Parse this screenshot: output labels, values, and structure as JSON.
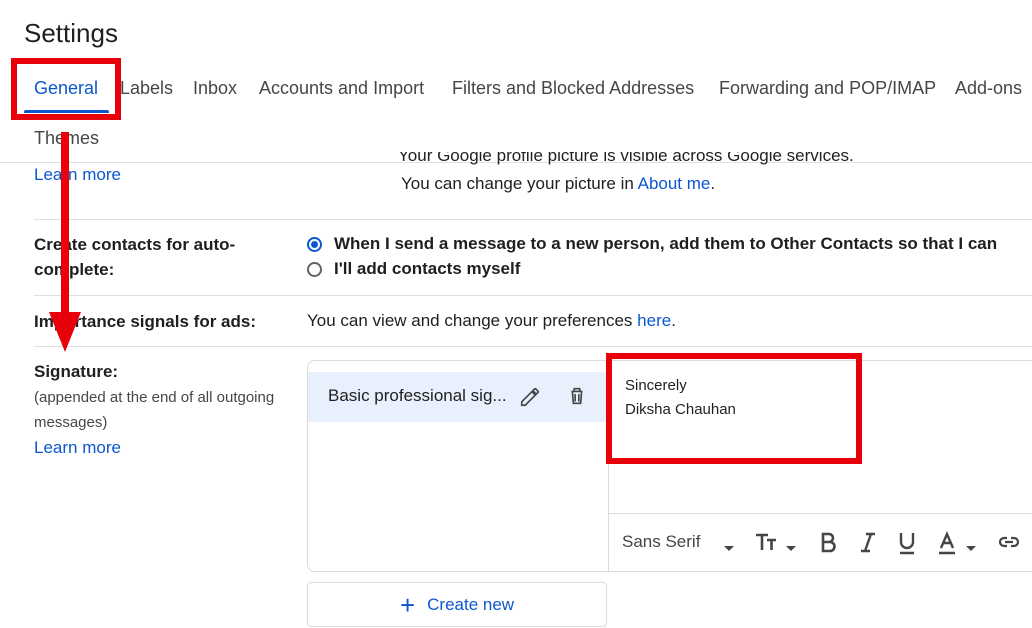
{
  "page_title": "Settings",
  "tabs": [
    "General",
    "Labels",
    "Inbox",
    "Accounts and Import",
    "Filters and Blocked Addresses",
    "Forwarding and POP/IMAP",
    "Add-ons",
    "Themes"
  ],
  "picture": {
    "clipped_line": "Your Google profile picture is visible across Google services.",
    "change_prefix": "You can change your picture in ",
    "about_me_link": "About me",
    "change_suffix": ".",
    "learn_more": "Learn more"
  },
  "auto_complete": {
    "label_line1": "Create contacts for auto-",
    "label_line2": "complete:",
    "option1": "When I send a message to a new person, add them to Other Contacts so that I can",
    "option2": "I'll add contacts myself"
  },
  "importance": {
    "label": "Importance signals for ads:",
    "text_prefix": "You can view and change your preferences ",
    "here_link": "here",
    "text_suffix": "."
  },
  "signature": {
    "label": "Signature:",
    "sub_line1": "(appended at the end of all outgoing",
    "sub_line2": "messages)",
    "learn_more": "Learn more",
    "item_name": "Basic professional sig...",
    "body_line1": "Sincerely",
    "body_line2": "Diksha Chauhan",
    "font_select": "Sans Serif",
    "create_new": "Create new"
  },
  "colors": {
    "accent": "#0b57d0",
    "annotation": "#e8000b",
    "selected_item_bg": "#e8f0fe"
  }
}
